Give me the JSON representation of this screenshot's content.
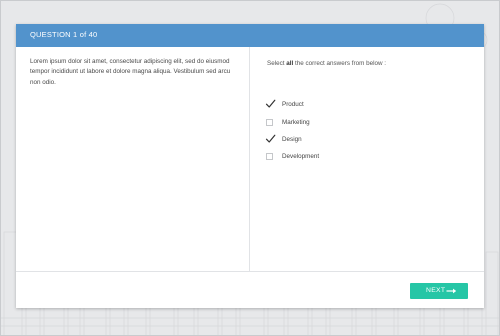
{
  "header": {
    "title": "QUESTION 1 of 40",
    "color": "#5293cc"
  },
  "passage": {
    "text": "Lorem ipsum dolor sit amet, consectetur adipiscing elit, sed do eiusmod tempor incididunt ut labore et dolore magna aliqua. Vestibulum sed arcu non odio."
  },
  "question": {
    "prompt_before": "Select ",
    "prompt_bold": "all",
    "prompt_after": " the correct answers from below :"
  },
  "options": [
    {
      "label": "Product",
      "checked": true
    },
    {
      "label": "Marketing",
      "checked": false
    },
    {
      "label": "Design",
      "checked": true
    },
    {
      "label": "Development",
      "checked": false
    }
  ],
  "footer": {
    "next_label": "NEXT",
    "next_icon": "arrow-right-icon",
    "next_color": "#26c6a6"
  }
}
